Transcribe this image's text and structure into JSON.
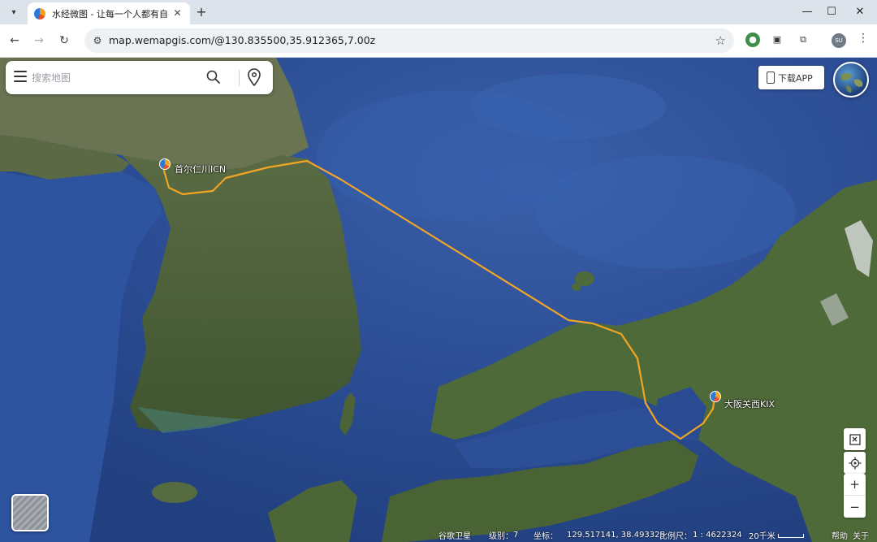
{
  "browser": {
    "tab_title": "水经微图 - 让每一个人都有自己的地图",
    "url": "map.wemapgis.com/@130.835500,35.912365,7.00z",
    "profile_initials": "SU"
  },
  "search": {
    "placeholder": "搜索地图"
  },
  "header": {
    "download_label": "下载APP"
  },
  "airports": [
    {
      "label": "首尔仁川ICN"
    },
    {
      "label": "大阪关西KIX"
    }
  ],
  "route_color": "#f2a524",
  "status": {
    "imagery": "谷歌卫星",
    "level_label": "级别：",
    "level_value": "7",
    "coord_label": "坐标：",
    "coord_value": "129.517141, 38.493325",
    "scale_label": "比例尺：",
    "scale_value": "1 : 4622324",
    "scale_distance": "20千米",
    "help": "帮助",
    "about": "关于"
  }
}
